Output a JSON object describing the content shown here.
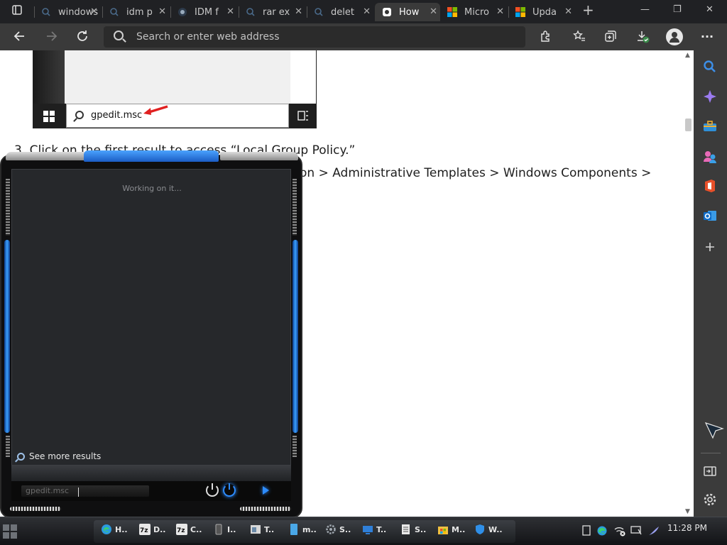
{
  "browser": {
    "tabs": [
      {
        "label": "windows",
        "icon": "search-icon"
      },
      {
        "label": "idm p",
        "icon": "search-icon"
      },
      {
        "label": "IDM f",
        "icon": "idm-icon"
      },
      {
        "label": "rar ex",
        "icon": "search-icon"
      },
      {
        "label": "delet",
        "icon": "search-icon"
      },
      {
        "label": "How",
        "icon": "site-icon",
        "active": true
      },
      {
        "label": "Micro",
        "icon": "microsoft-icon"
      },
      {
        "label": "Upda",
        "icon": "microsoft-icon"
      }
    ],
    "new_tab": "+",
    "window_controls": {
      "minimize": "—",
      "restore": "❐",
      "close": "✕"
    },
    "address_placeholder": "Search or enter web address",
    "more_label": "···"
  },
  "page": {
    "screenshot_search_text": "gpedit.msc",
    "step3": "3.  Click on the first result to access “Local Group Policy.”",
    "step4_fragment": "on > Administrative Templates > Windows Components >"
  },
  "startmenu": {
    "status": "Working on it...",
    "see_more": "See more results",
    "search_value": "gpedit.msc"
  },
  "taskbar": {
    "items": [
      {
        "label": "H..",
        "icon": "edge-icon",
        "color": "#2b9be0"
      },
      {
        "label": "D..",
        "icon": "7zip-icon",
        "color": "#e8e8e8"
      },
      {
        "label": "C..",
        "icon": "7zip-icon",
        "color": "#e8e8e8"
      },
      {
        "label": "I..",
        "icon": "phone-icon",
        "color": "#8a8a8a"
      },
      {
        "label": "T..",
        "icon": "window-icon",
        "color": "#d8d8d8"
      },
      {
        "label": "m..",
        "icon": "document-icon",
        "color": "#4aa8e8"
      },
      {
        "label": "S..",
        "icon": "settings-icon",
        "color": "#a0a8b0"
      },
      {
        "label": "T..",
        "icon": "screen-icon",
        "color": "#2f7fd8"
      },
      {
        "label": "S..",
        "icon": "notepad-icon",
        "color": "#e8e8e8"
      },
      {
        "label": "M..",
        "icon": "store-icon",
        "color": "#f0c040"
      },
      {
        "label": "W..",
        "icon": "shield-icon",
        "color": "#2f8fe8"
      }
    ],
    "clock": "11:28 PM"
  },
  "colors": {
    "accent_blue": "#2d8cff",
    "tabbar": "#202124",
    "toolbar": "#3a3a3a",
    "sidebar": "#3b3b3b"
  }
}
